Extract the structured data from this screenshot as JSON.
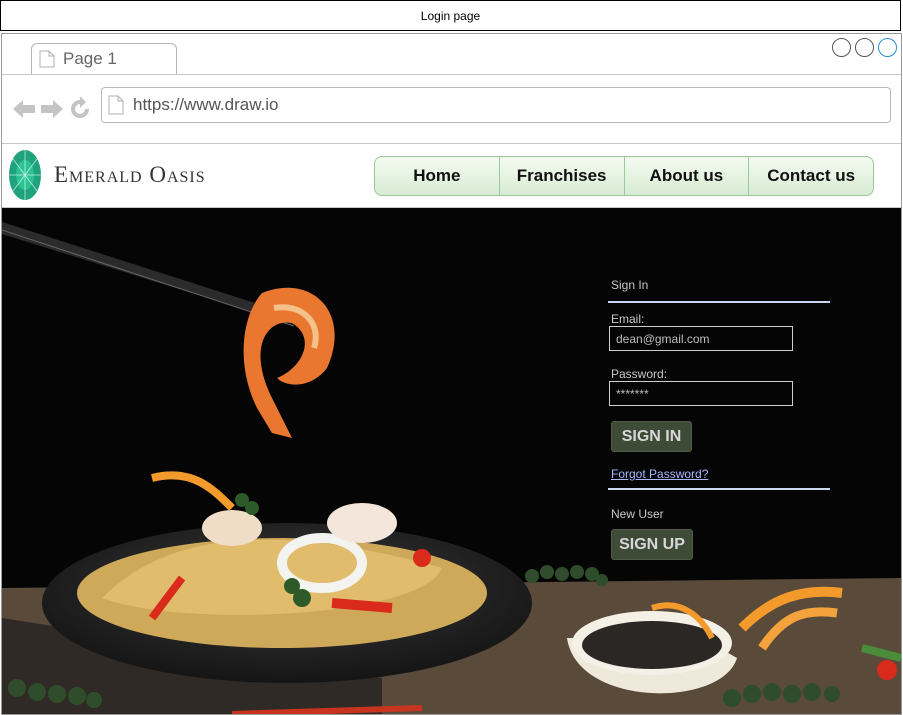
{
  "window": {
    "title": "Login page"
  },
  "browser": {
    "tab_label": "Page 1",
    "url": "https://www.draw.io",
    "window_controls": [
      "circle-button",
      "circle-button",
      "circle-button"
    ]
  },
  "site": {
    "brand": "Emerald Oasis",
    "logo_icon": "emerald-gem-icon",
    "nav": [
      "Home",
      "Franchises",
      "About us",
      "Contact us"
    ]
  },
  "signin": {
    "heading": "Sign In",
    "email_label": "Email:",
    "email_value": "dean@gmail.com",
    "password_label": "Password:",
    "password_value": "*******",
    "signin_button": "SIGN IN",
    "forgot_link": "Forgot Password?",
    "new_user_label": "New User",
    "signup_button": "SIGN UP"
  },
  "colors": {
    "accent_green": "#3e4b37",
    "menu_border": "#9ec79a",
    "link": "#a9b8ff",
    "emerald": "#1fa37c"
  }
}
